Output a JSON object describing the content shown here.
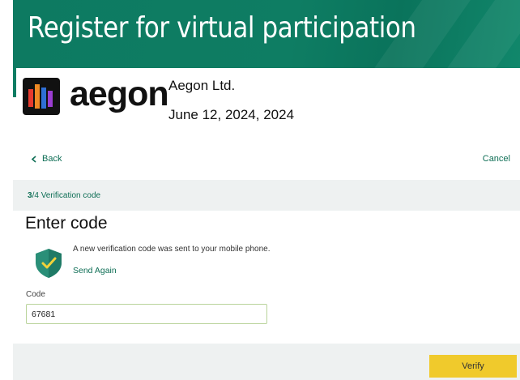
{
  "banner": {
    "title": "Register for virtual participation"
  },
  "header": {
    "logo_text": "aegon",
    "company": "Aegon Ltd.",
    "date": "June 12, 2024, 2024"
  },
  "nav": {
    "back_label": "Back",
    "cancel_label": "Cancel"
  },
  "step": {
    "current": "3",
    "total": "4",
    "label": "Verification code"
  },
  "main": {
    "heading": "Enter code",
    "message": "A new verification code was sent to your mobile phone.",
    "send_again": "Send Again",
    "code_label": "Code",
    "code_value": "67681"
  },
  "footer": {
    "verify_label": "Verify"
  },
  "colors": {
    "brand_green": "#0e7d63",
    "link_green": "#0e6e55",
    "verify_yellow": "#f0ca2c",
    "panel_gray": "#eef1f1"
  }
}
